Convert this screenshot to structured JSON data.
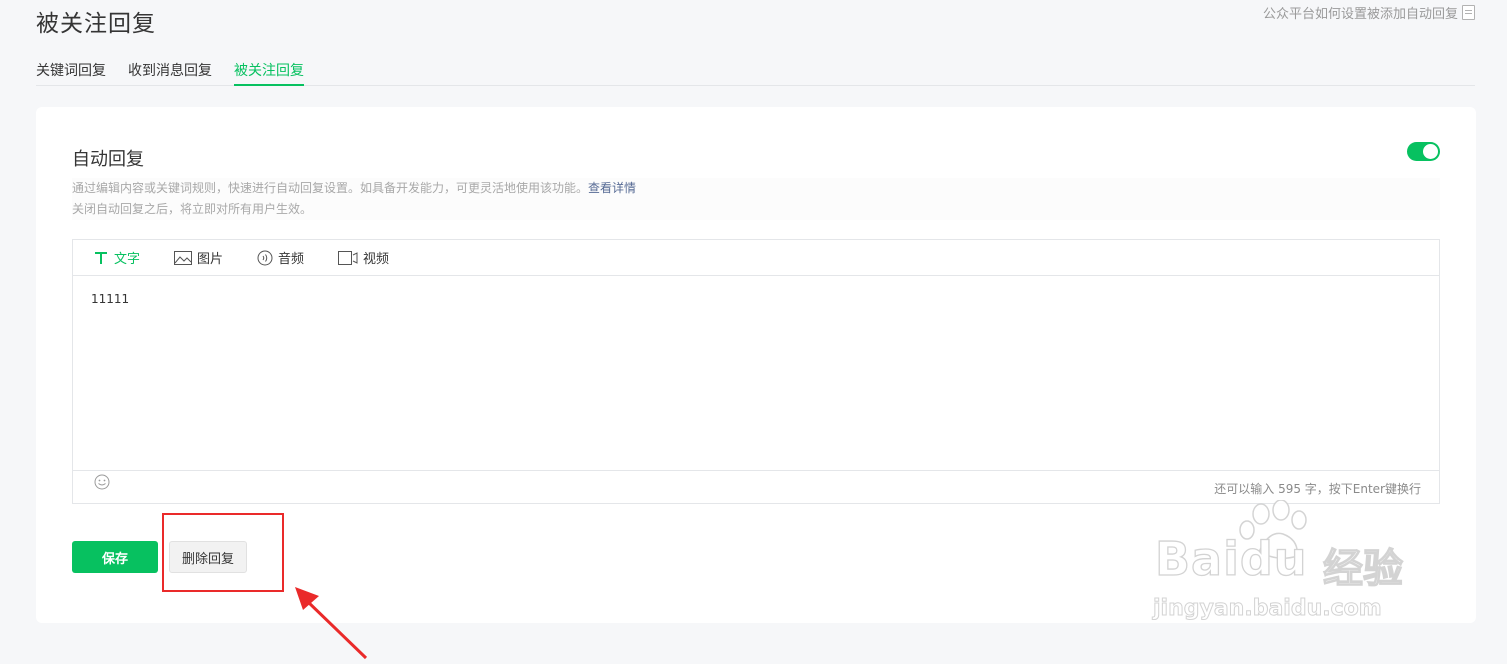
{
  "page": {
    "title": "被关注回复",
    "help_link": "公众平台如何设置被添加自动回复"
  },
  "tabs": [
    {
      "label": "关键词回复",
      "active": false
    },
    {
      "label": "收到消息回复",
      "active": false
    },
    {
      "label": "被关注回复",
      "active": true
    }
  ],
  "auto_reply": {
    "title": "自动回复",
    "enabled": true,
    "desc_line1": "通过编辑内容或关键词规则，快速进行自动回复设置。如具备开发能力，可更灵活地使用该功能。",
    "desc_link": "查看详情",
    "desc_line2": "关闭自动回复之后，将立即对所有用户生效。"
  },
  "editor": {
    "tabs": [
      {
        "label": "文字",
        "icon": "text-icon",
        "active": true
      },
      {
        "label": "图片",
        "icon": "image-icon",
        "active": false
      },
      {
        "label": "音频",
        "icon": "audio-icon",
        "active": false
      },
      {
        "label": "视频",
        "icon": "video-icon",
        "active": false
      }
    ],
    "content": "11111",
    "counter": "还可以输入 595 字，按下Enter键换行"
  },
  "actions": {
    "save_label": "保存",
    "delete_label": "删除回复"
  },
  "watermark": {
    "brand": "Bai",
    "brand_suffix": "du",
    "product": "经验",
    "url": "jingyan.baidu.com"
  },
  "colors": {
    "accent": "#07c160",
    "annotation": "#ea2a2a",
    "link": "#576b95"
  }
}
